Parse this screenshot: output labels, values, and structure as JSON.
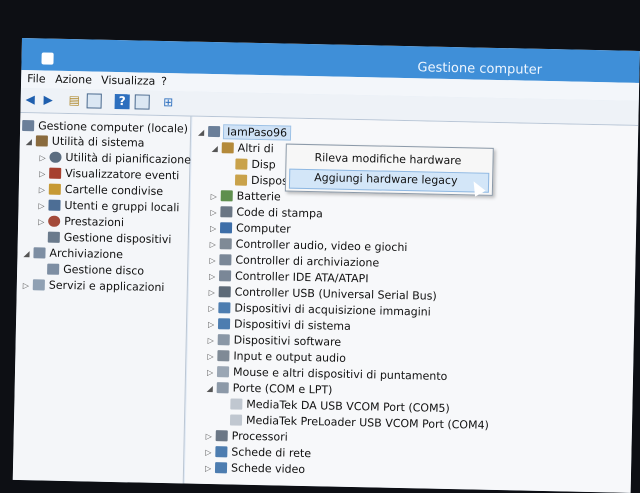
{
  "window": {
    "title": "Gestione computer"
  },
  "menu": [
    "File",
    "Azione",
    "Visualizza",
    "?"
  ],
  "toolbar": {
    "icons": [
      "back-icon",
      "forward-icon",
      "folder-up-icon",
      "properties-icon",
      "help-icon",
      "show-hide-icon",
      "scan-hardware-icon"
    ]
  },
  "left_tree": {
    "root": "Gestione computer (locale)",
    "system_tools": "Utilità di sistema",
    "items": [
      "Utilità di pianificazione",
      "Visualizzatore eventi",
      "Cartelle condivise",
      "Utenti e gruppi locali",
      "Prestazioni",
      "Gestione dispositivi"
    ],
    "storage": "Archiviazione",
    "disk": "Gestione disco",
    "services": "Servizi e applicazioni"
  },
  "device_tree": {
    "computer_name": "IamPaso96",
    "other_devices": "Altri di",
    "other_children": [
      "Disp",
      "Dispositivo sconosciuto"
    ],
    "categories": [
      "Batterie",
      "Code di stampa",
      "Computer",
      "Controller audio, video e giochi",
      "Controller di archiviazione",
      "Controller IDE ATA/ATAPI",
      "Controller USB (Universal Serial Bus)",
      "Dispositivi di acquisizione immagini",
      "Dispositivi di sistema",
      "Dispositivi software",
      "Input e output audio",
      "Mouse e altri dispositivi di puntamento"
    ],
    "ports": "Porte (COM e LPT)",
    "port_children": [
      "MediaTek DA USB VCOM Port (COM5)",
      "MediaTek PreLoader USB VCOM Port (COM4)"
    ],
    "after": [
      "Processori",
      "Schede di rete",
      "Schede video"
    ]
  },
  "context_menu": {
    "items": [
      "Rileva modifiche hardware",
      "Aggiungi hardware legacy"
    ],
    "highlighted": "Aggiungi hardware legacy"
  },
  "colors": {
    "titlebar": "#3f8fd8",
    "selection": "#cfe2f6"
  }
}
